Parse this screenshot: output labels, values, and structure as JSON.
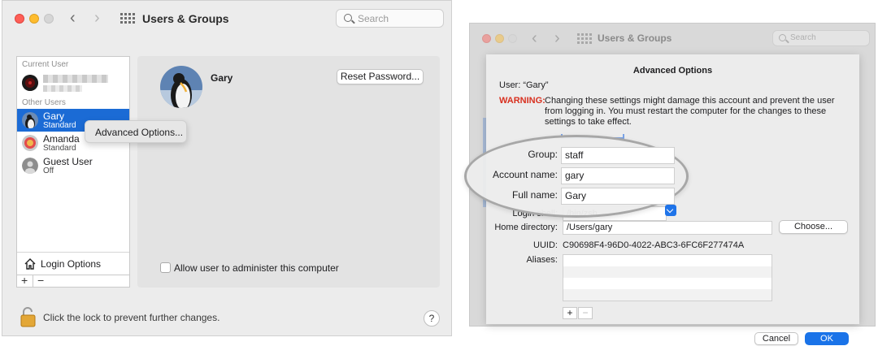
{
  "left_window": {
    "title": "Users & Groups",
    "search_placeholder": "Search",
    "sections": {
      "current_user": "Current User",
      "other_users": "Other Users"
    },
    "users": [
      {
        "name": "Gary",
        "role": "Standard",
        "selected": true
      },
      {
        "name": "Amanda",
        "role": "Standard",
        "selected": false
      },
      {
        "name": "Guest User",
        "role": "Off",
        "selected": false
      }
    ],
    "login_options": "Login Options",
    "plus": "+",
    "minus": "−",
    "context_menu_item": "Advanced Options...",
    "detail": {
      "user_name": "Gary",
      "reset_password": "Reset Password...",
      "admin_checkbox_label": "Allow user to administer this computer",
      "admin_checked": false
    },
    "lock_text": "Click the lock to prevent further changes.",
    "help": "?"
  },
  "right_window": {
    "title": "Users & Groups",
    "search_placeholder": "Search"
  },
  "advanced_sheet": {
    "title": "Advanced Options",
    "user_line": "User: “Gary”",
    "warning_label": "WARNING:",
    "warning_text": "Changing these settings might damage this account and prevent the user from logging in. You must restart the computer for the changes to these settings to take effect.",
    "fields": {
      "group_label": "Group:",
      "group_value": "staff",
      "account_label": "Account name:",
      "account_value": "gary",
      "fullname_label": "Full name:",
      "fullname_value": "Gary",
      "shell_label": "Login shell:",
      "shell_value": "/bin/zsh",
      "home_label": "Home directory:",
      "home_value": "/Users/gary",
      "choose": "Choose...",
      "uuid_label": "UUID:",
      "uuid_value": "C90698F4-96D0-4022-ABC3-6FC6F277474A",
      "aliases_label": "Aliases:"
    },
    "plus": "+",
    "minus": "−",
    "cancel": "Cancel",
    "ok": "OK"
  },
  "colors": {
    "selection": "#1b6bd5",
    "warning": "#d8301f",
    "accent": "#1a73e8"
  }
}
